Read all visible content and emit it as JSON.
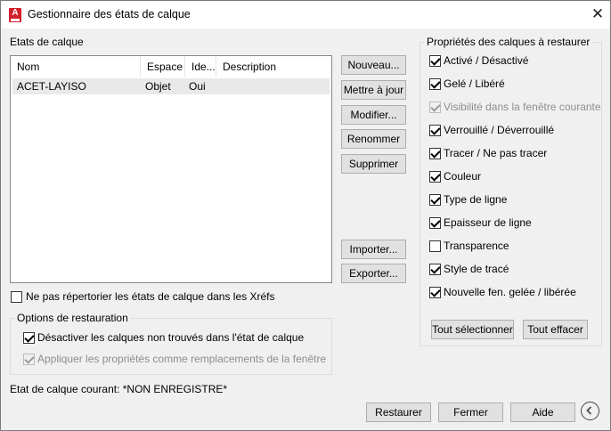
{
  "window": {
    "title": "Gestionnaire des états de calque",
    "close_glyph": "✕",
    "app_icon_letter": "A"
  },
  "states_section": {
    "label": "Etats de calque"
  },
  "table": {
    "columns": [
      "Nom",
      "Espace",
      "Ide...",
      "Description"
    ],
    "rows": [
      {
        "name": "ACET-LAYISO",
        "space": "Objet",
        "ide": "Oui",
        "description": ""
      }
    ]
  },
  "buttons": {
    "new": "Nouveau...",
    "update": "Mettre à jour",
    "edit": "Modifier...",
    "rename": "Renommer",
    "delete": "Supprimer",
    "import": "Importer...",
    "export": "Exporter...",
    "select_all": "Tout sélectionner",
    "clear_all": "Tout effacer",
    "restore": "Restaurer",
    "close": "Fermer",
    "help": "Aide"
  },
  "xref_checkbox": {
    "label": "Ne pas répertorier les états de calque dans les Xréfs",
    "checked": false
  },
  "restore_options": {
    "title": "Options de restauration",
    "items": [
      {
        "label": "Désactiver les calques non trouvés dans l'état de calque",
        "checked": true,
        "disabled": false
      },
      {
        "label": "Appliquer les propriétés comme remplacements de la fenêtre",
        "checked": true,
        "disabled": true
      }
    ]
  },
  "properties": {
    "title": "Propriétés des calques à restaurer",
    "items": [
      {
        "label": "Activé / Désactivé",
        "checked": true,
        "disabled": false
      },
      {
        "label": "Gelé / Libéré",
        "checked": true,
        "disabled": false
      },
      {
        "label": "Visibilité dans la fenêtre courante",
        "checked": true,
        "disabled": true
      },
      {
        "label": "Verrouillé / Déverrouillé",
        "checked": true,
        "disabled": false
      },
      {
        "label": "Tracer / Ne pas tracer",
        "checked": true,
        "disabled": false
      },
      {
        "label": "Couleur",
        "checked": true,
        "disabled": false
      },
      {
        "label": "Type de ligne",
        "checked": true,
        "disabled": false
      },
      {
        "label": "Epaisseur de ligne",
        "checked": true,
        "disabled": false
      },
      {
        "label": "Transparence",
        "checked": false,
        "disabled": false
      },
      {
        "label": "Style de tracé",
        "checked": true,
        "disabled": false
      },
      {
        "label": "Nouvelle fen. gelée / libérée",
        "checked": true,
        "disabled": false
      }
    ]
  },
  "current_state": {
    "text": "Etat de calque courant: *NON ENREGISTRE*"
  },
  "colors": {
    "app_icon": "#d21f2b",
    "selected_row": "#e9e9e9",
    "disabled_text": "#8d8d8d"
  }
}
